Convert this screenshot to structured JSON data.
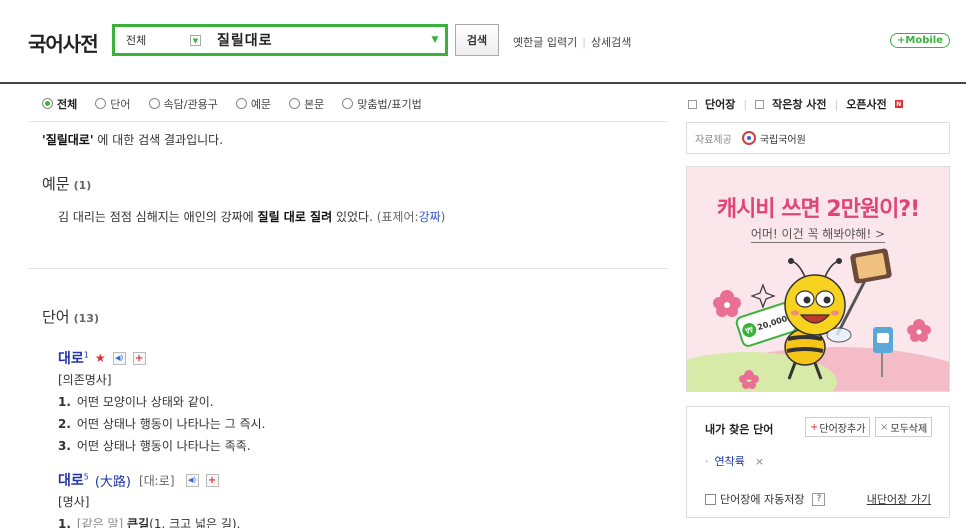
{
  "header": {
    "logo": "국어사전",
    "scope": "전체",
    "query": "질릴대로",
    "search_button": "검색",
    "links": [
      "옛한글 입력기",
      "상세검색"
    ],
    "mobile": "+Mobile"
  },
  "filters": [
    {
      "label": "전체",
      "selected": true
    },
    {
      "label": "단어",
      "selected": false
    },
    {
      "label": "속담/관용구",
      "selected": false
    },
    {
      "label": "예문",
      "selected": false
    },
    {
      "label": "본문",
      "selected": false
    },
    {
      "label": "맞춤법/표기법",
      "selected": false
    }
  ],
  "result": {
    "quote_open": "'",
    "term": "질릴대로",
    "quote_close": "'",
    "suffix": " 에 대한 검색 결과입니다."
  },
  "examples_section": {
    "title": "예문",
    "count": "(1)",
    "sentence_pre": "김 대리는 점점 심해지는 애인의 강짜에 ",
    "sentence_bold": "질릴 대로 질려",
    "sentence_post": " 있었다.",
    "ref_pre": " (표제어:",
    "ref_word": "강짜",
    "ref_post": ")"
  },
  "words_section": {
    "title": "단어",
    "count": "(13)",
    "entries": [
      {
        "word": "대로",
        "sup": "1",
        "hanja": "",
        "pron": "",
        "pos": "[의존명사]",
        "defs": [
          {
            "num": "1.",
            "text": "어떤 모양이나 상태와 같이."
          },
          {
            "num": "2.",
            "text": "어떤 상태나 행동이 나타나는 그 즉시."
          },
          {
            "num": "3.",
            "text": "어떤 상태나 행동이 나타나는 족족."
          }
        ]
      },
      {
        "word": "대로",
        "sup": "5",
        "hanja": "(大路)",
        "pron": "[대ː로]",
        "pos": "[명사]",
        "defs": [
          {
            "num": "1.",
            "gray": "[같은 말] ",
            "bold": "큰길",
            "text": "(1. 크고 넓은 길)."
          }
        ]
      }
    ]
  },
  "sidebar": {
    "tools": [
      "단어장",
      "작은창 사전",
      "오픈사전"
    ],
    "new_badge": "N",
    "provider_label": "자료제공",
    "provider_org": "국립국어원",
    "ad": {
      "title": "캐시비 쓰면 2만원이?!",
      "subtitle": "어머! 이건 꼭 해봐야해! >",
      "coin_label": "20,000",
      "coin_symbol": "₩"
    },
    "mylist": {
      "title": "내가 찾은 단어",
      "add_button": "단어장추가",
      "add_mark": "+",
      "delete_button": "모두삭제",
      "delete_mark": "×",
      "words": [
        "연착륙"
      ],
      "bullet": "·",
      "remove_mark": "×",
      "auto_save_label": "단어장에 자동저장",
      "help": "?",
      "go_link": "내단어장 가기"
    }
  },
  "colors": {
    "accent_green": "#3bb33b",
    "word_blue": "#2236a8",
    "ad_pink": "#e0457a",
    "ad_bg": "#fbe6ec"
  }
}
